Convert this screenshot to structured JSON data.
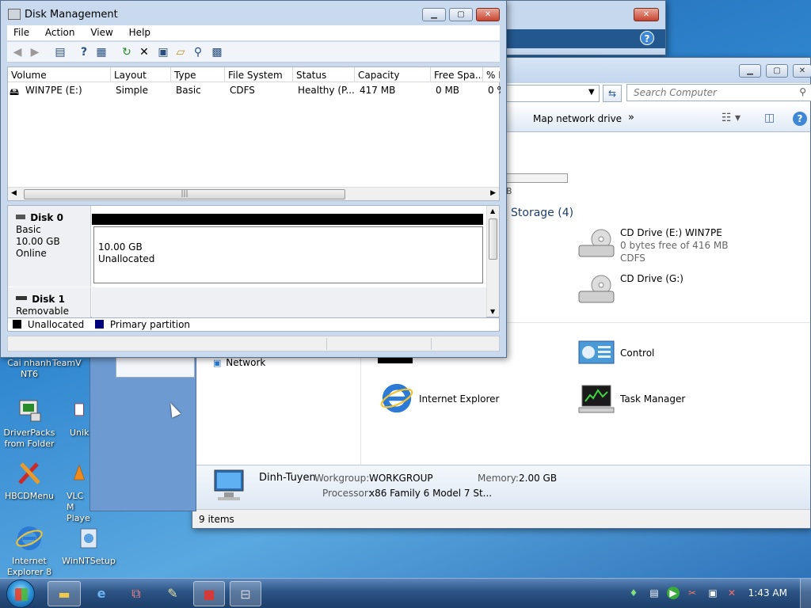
{
  "desktop": {
    "icons": [
      {
        "label": "Cai nhanh NT6"
      },
      {
        "label": "TeamV"
      },
      {
        "label": "DriverPacks from Folder"
      },
      {
        "label": "Unik"
      },
      {
        "label": "HBCDMenu"
      },
      {
        "label": "VLC M Playe"
      },
      {
        "label": "Internet Explorer 8"
      },
      {
        "label": "WinNTSetup"
      }
    ]
  },
  "disk_management": {
    "title": "Disk Management",
    "menu": [
      "File",
      "Action",
      "View",
      "Help"
    ],
    "columns": [
      "Volume",
      "Layout",
      "Type",
      "File System",
      "Status",
      "Capacity",
      "Free Spa...",
      "% F"
    ],
    "row": {
      "volume": "WIN7PE (E:)",
      "layout": "Simple",
      "type": "Basic",
      "file_system": "CDFS",
      "status": "Healthy (P...",
      "capacity": "417 MB",
      "free": "0 MB",
      "pct": "0 %"
    },
    "disk0": {
      "name": "Disk 0",
      "type": "Basic",
      "size": "10.00 GB",
      "state": "Online",
      "partition_size": "10.00 GB",
      "partition_state": "Unallocated"
    },
    "disk1": {
      "name": "Disk 1",
      "type": "Removable (F:)"
    },
    "legend": {
      "unallocated": "Unallocated",
      "primary": "Primary partition",
      "unallocated_color": "#000000",
      "primary_color": "#00007f"
    }
  },
  "explorer": {
    "search_placeholder": "Search Computer",
    "cmd_map_drive": "Map network drive",
    "cmd_more": "»",
    "section_storage": "Storage (4)",
    "partial_tick": "B",
    "drives": [
      {
        "name": "CD Drive (E:) WIN7PE",
        "free": "0 bytes free of 416 MB",
        "fs": "CDFS"
      },
      {
        "name": "CD Drive (G:)"
      }
    ],
    "items": {
      "network": "Network",
      "control": "Control",
      "ie": "Internet Explorer",
      "task_manager": "Task Manager"
    },
    "details": {
      "computer_name": "Dinh-Tuyen",
      "workgroup_label": "Workgroup:",
      "workgroup": "WORKGROUP",
      "memory_label": "Memory:",
      "memory": "2.00 GB",
      "processor_label": "Processor:",
      "processor": "x86 Family 6 Model 7 St..."
    },
    "status": "9 items"
  },
  "taskbar": {
    "clock": "1:43 AM"
  }
}
